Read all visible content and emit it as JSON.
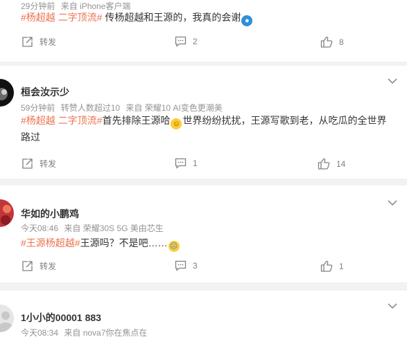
{
  "posts": [
    {
      "author": "",
      "meta": [
        "29分钟前",
        "来自 iPhone客户端"
      ],
      "tags": [
        "#杨超越",
        "二字顶流#"
      ],
      "body": "传杨超越和王源的，我真的会谢",
      "emoji": "doraemon",
      "actions": {
        "repost_label": "转发",
        "comments": "2",
        "likes": "8"
      }
    },
    {
      "author": "桓会汝示少",
      "meta": [
        "59分钟前",
        "转赞人数超过10",
        "来自 荣耀10 AI变色更潮美"
      ],
      "tags": [
        "#杨超越",
        "二字顶流#"
      ],
      "body_before": "首先排除王源哈",
      "emoji": "grin",
      "body_after": "世界纷纷扰扰，王源写歌到老，从吃瓜的全世界路过",
      "actions": {
        "repost_label": "转发",
        "comments": "1",
        "likes": "14"
      }
    },
    {
      "author": "华如的小鹏鸡",
      "meta": [
        "今天08:46",
        "来自 荣耀30S 5G 美由芯生"
      ],
      "tags": [
        "#王源杨超越#"
      ],
      "body": "王源吗？不是吧……",
      "emoji": "cry",
      "actions": {
        "repost_label": "转发",
        "comments": "3",
        "likes": "1"
      }
    },
    {
      "author": "1小小的00001 883",
      "meta": [
        "今天08:34",
        "来自 nova7你在焦点在"
      ],
      "actions": {}
    }
  ],
  "colors": {
    "tag": "#eb7350",
    "meta": "#939393",
    "background": "#f2f2f2"
  },
  "icons": [
    "repost-icon",
    "comment-icon",
    "like-icon",
    "chevron-down-icon"
  ]
}
